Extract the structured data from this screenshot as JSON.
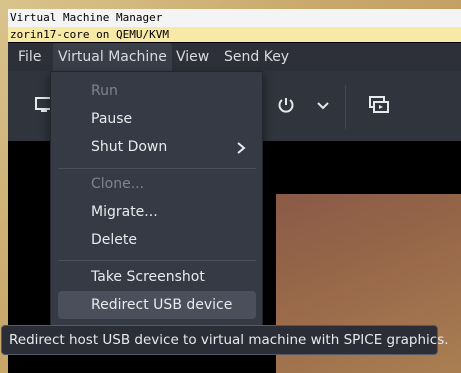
{
  "titlebar": {
    "outer_title": "Virtual Machine Manager",
    "window_title": "zorin17-core on QEMU/KVM"
  },
  "menubar": {
    "items": [
      "File",
      "Virtual Machine",
      "View",
      "Send Key"
    ],
    "active": "Virtual Machine"
  },
  "toolbar": {
    "icons": [
      "monitor-icon",
      "power-icon",
      "chevron-down-icon",
      "screenshot-window-icon"
    ]
  },
  "vm_menu": {
    "items": [
      {
        "label": "Run",
        "disabled": true
      },
      {
        "label": "Pause",
        "disabled": false
      },
      {
        "label": "Shut Down",
        "disabled": false,
        "submenu": true
      },
      {
        "label": "Clone...",
        "disabled": true
      },
      {
        "label": "Migrate...",
        "disabled": false
      },
      {
        "label": "Delete",
        "disabled": false
      },
      {
        "label": "Take Screenshot",
        "disabled": false
      },
      {
        "label": "Redirect USB device",
        "disabled": false,
        "highlighted": true
      }
    ]
  },
  "tooltip": {
    "text": "Redirect host USB device to virtual machine with SPICE graphics."
  }
}
